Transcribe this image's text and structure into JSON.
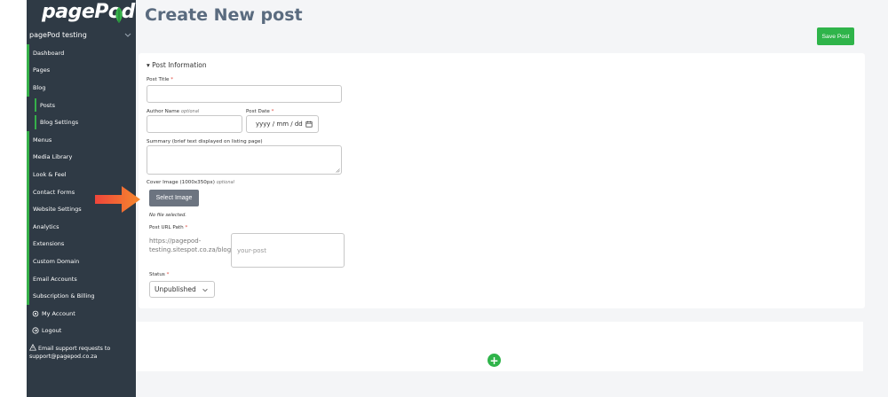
{
  "sidebar": {
    "logo": "pagePod",
    "site_name": "pagePod testing",
    "items": [
      {
        "label": "Dashboard"
      },
      {
        "label": "Pages"
      },
      {
        "label": "Blog"
      },
      {
        "label": "Posts"
      },
      {
        "label": "Blog Settings"
      },
      {
        "label": "Menus"
      },
      {
        "label": "Media Library"
      },
      {
        "label": "Look & Feel"
      },
      {
        "label": "Contact Forms"
      },
      {
        "label": "Website Settings"
      },
      {
        "label": "Analytics"
      },
      {
        "label": "Extensions"
      },
      {
        "label": "Custom Domain"
      },
      {
        "label": "Email Accounts"
      },
      {
        "label": "Subscription & Billing"
      },
      {
        "label": "My Account"
      },
      {
        "label": "Logout"
      }
    ],
    "support_text": "Email support requests to support@pagepod.co.za"
  },
  "main": {
    "title": "Create New post",
    "save_label": "Save Post",
    "section_title": "▾ Post Information",
    "post_title_label": "Post Title",
    "author_label": "Author Name",
    "optional": "optional",
    "post_date_label": "Post Date",
    "post_date_placeholder": "yyyy / mm / dd",
    "summary_label": "Summary (brief text displayed on listing page)",
    "cover_label": "Cover Image (1000x350px)",
    "select_image_label": "Select Image",
    "no_file": "No file selected.",
    "url_label": "Post URL Path",
    "url_prefix": "https://pagepod-testing.sitespot.co.za/blog/",
    "url_placeholder": "your-post",
    "status_label": "Status",
    "status_value": "Unpublished",
    "required_mark": "*",
    "add_symbol": "+"
  },
  "colors": {
    "sidebar_bg": "#2f3a45",
    "accent_green": "#2fb44a",
    "title_color": "#5a6b7f",
    "arrow": "#f05a3a"
  },
  "icons": [
    "leaf-icon",
    "chevron-down-icon",
    "calendar-icon",
    "gear-icon",
    "logout-icon",
    "warning-icon",
    "plus-icon",
    "arrow-pointer"
  ]
}
